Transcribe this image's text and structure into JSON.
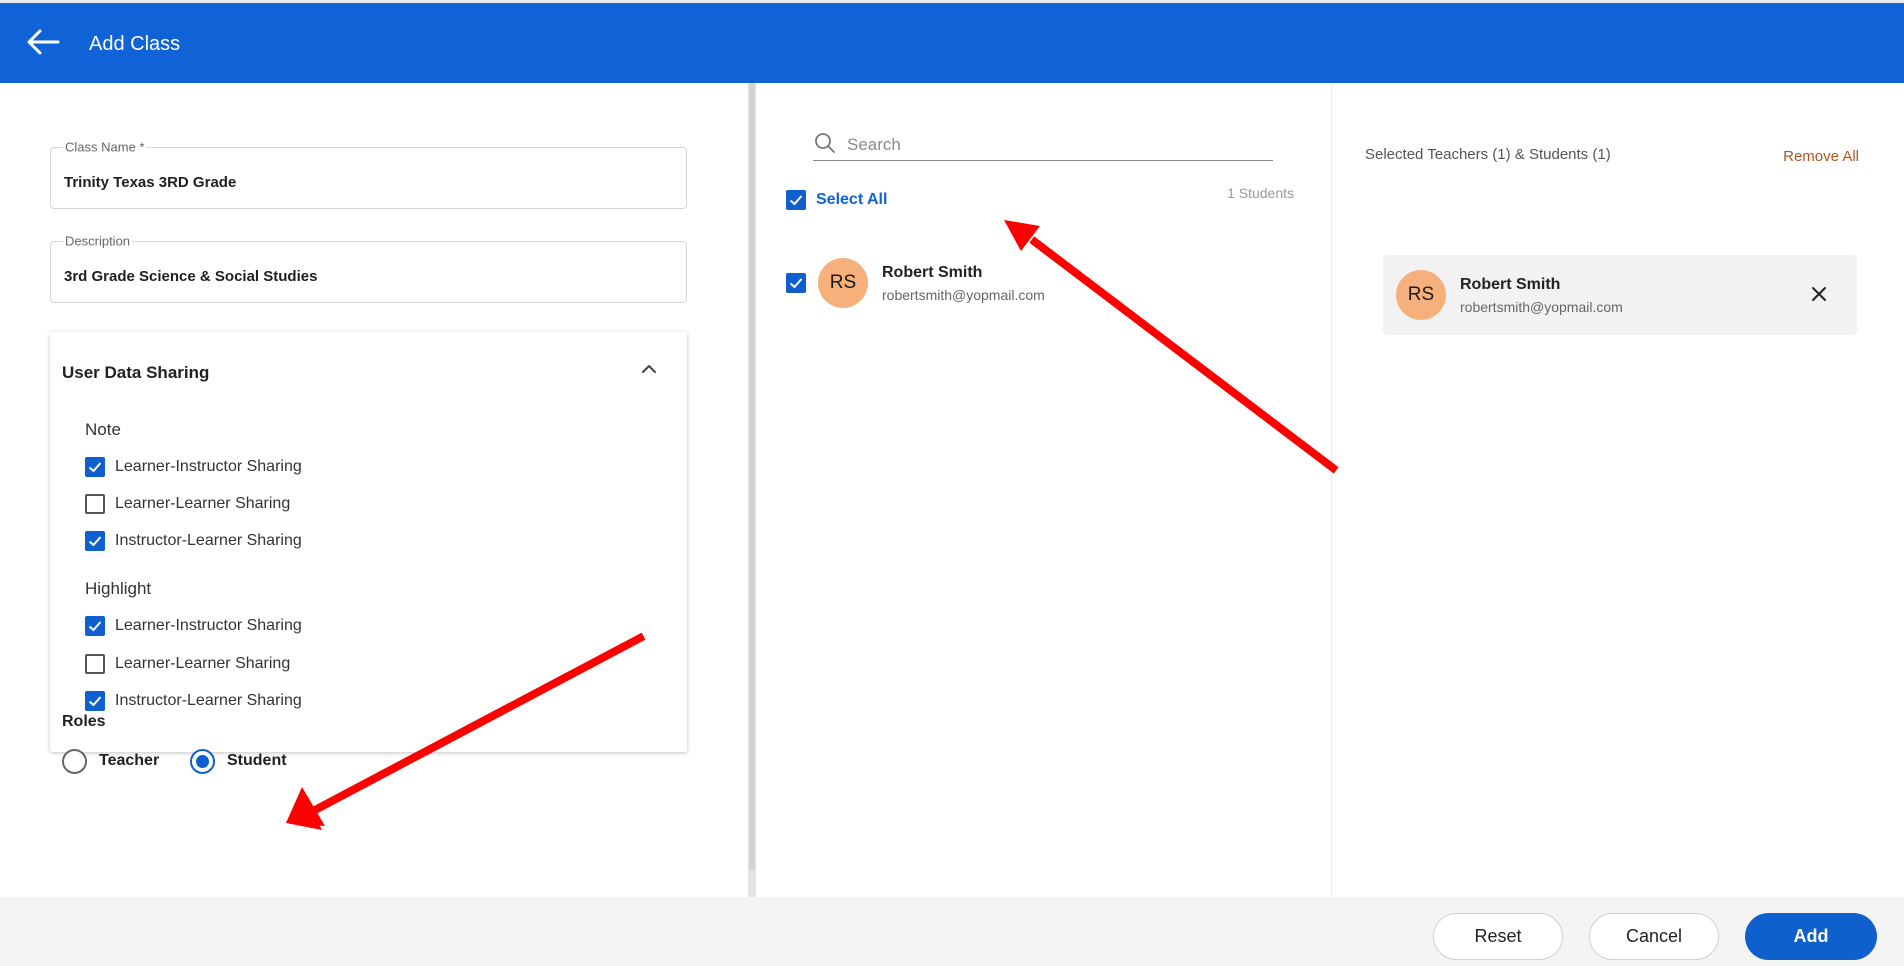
{
  "header": {
    "title": "Add Class"
  },
  "form": {
    "class_name": {
      "label": "Class Name *",
      "value": "Trinity Texas 3RD Grade"
    },
    "description": {
      "label": "Description",
      "value": "3rd Grade Science & Social Studies"
    }
  },
  "sharing": {
    "title": "User Data Sharing",
    "groups": [
      {
        "label": "Note",
        "options": [
          {
            "label": "Learner-Instructor Sharing",
            "checked": true
          },
          {
            "label": "Learner-Learner Sharing",
            "checked": false
          },
          {
            "label": "Instructor-Learner Sharing",
            "checked": true
          }
        ]
      },
      {
        "label": "Highlight",
        "options": [
          {
            "label": "Learner-Instructor Sharing",
            "checked": true
          },
          {
            "label": "Learner-Learner Sharing",
            "checked": false
          },
          {
            "label": "Instructor-Learner Sharing",
            "checked": true
          }
        ]
      }
    ]
  },
  "roles": {
    "label": "Roles",
    "options": [
      {
        "label": "Teacher",
        "selected": false
      },
      {
        "label": "Student",
        "selected": true
      }
    ]
  },
  "search": {
    "placeholder": "Search"
  },
  "list": {
    "select_all_label": "Select All",
    "count_text": "1 Students",
    "students": [
      {
        "initials": "RS",
        "name": "Robert Smith",
        "email": "robertsmith@yopmail.com",
        "checked": true
      }
    ]
  },
  "selected": {
    "title": "Selected Teachers (1) & Students (1)",
    "remove_all": "Remove All",
    "people": [
      {
        "initials": "RS",
        "name": "Robert Smith",
        "email": "robertsmith@yopmail.com"
      }
    ]
  },
  "footer": {
    "reset_label": "Reset",
    "cancel_label": "Cancel",
    "add_label": "Add"
  },
  "colors": {
    "primary": "#0f63d7",
    "remove_all": "#b3541e",
    "avatar": "#f6b07c",
    "annotation": "#ff0000"
  }
}
